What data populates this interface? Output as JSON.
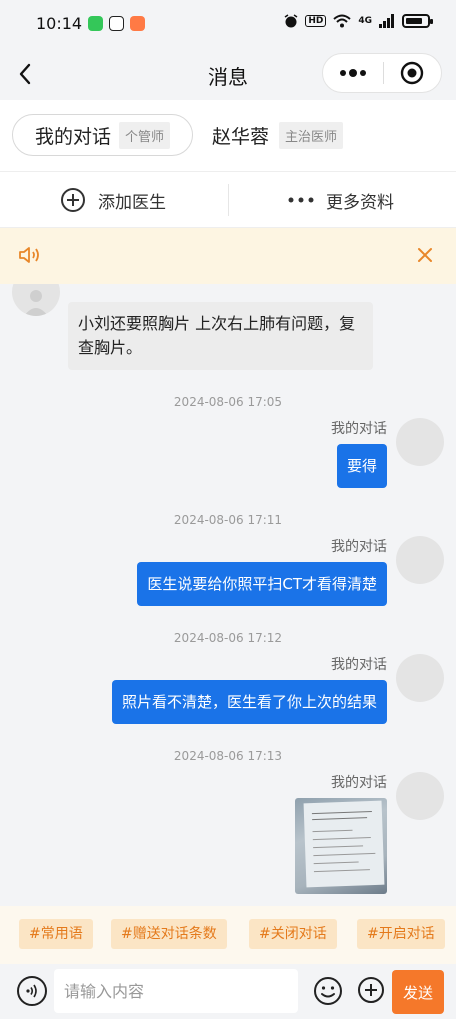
{
  "status_bar": {
    "time": "10:14",
    "network": "4G",
    "hd_label": "HD",
    "app_icons": [
      {
        "name": "green-app-icon",
        "color": "#34c759"
      },
      {
        "name": "reader-app-icon",
        "color": "#222222"
      },
      {
        "name": "game-app-icon",
        "color": "#ff7a45"
      }
    ]
  },
  "nav": {
    "title": "消息",
    "icons": {
      "back": "back-arrow-icon",
      "more": "more-dots-icon",
      "close": "target-close-icon"
    }
  },
  "tabs": [
    {
      "name": "我的对话",
      "badge": "个管师",
      "active": true
    },
    {
      "name": "赵华蓉",
      "badge": "主治医师",
      "active": false
    }
  ],
  "actions": {
    "add_doctor": "添加医生",
    "more_info": "更多资料"
  },
  "notice": {
    "icons": {
      "speaker": "speaker-icon",
      "close": "close-icon"
    }
  },
  "chat": {
    "incoming_text": "小刘还要照胸片 上次右上肺有问题，复查胸片。",
    "messages": [
      {
        "timestamp": "2024-08-06 17:05",
        "sender": "我的对话",
        "text": "要得"
      },
      {
        "timestamp": "2024-08-06 17:11",
        "sender": "我的对话",
        "text": "医生说要给你照平扫CT才看得清楚"
      },
      {
        "timestamp": "2024-08-06 17:12",
        "sender": "我的对话",
        "text": "照片看不清楚，医生看了你上次的结果"
      },
      {
        "timestamp": "2024-08-06 17:13",
        "sender": "我的对话",
        "image": "medical-report-photo"
      }
    ]
  },
  "quick_tags": [
    "#常用语",
    "#赠送对话条数",
    "#关闭对话",
    "#开启对话"
  ],
  "input": {
    "placeholder": "请输入内容",
    "send_label": "发送"
  },
  "colors": {
    "accent_blue": "#1a73e8",
    "send_orange": "#f5782a",
    "tag_text": "#e47a1c",
    "notice_bg": "#fdf5e2"
  }
}
